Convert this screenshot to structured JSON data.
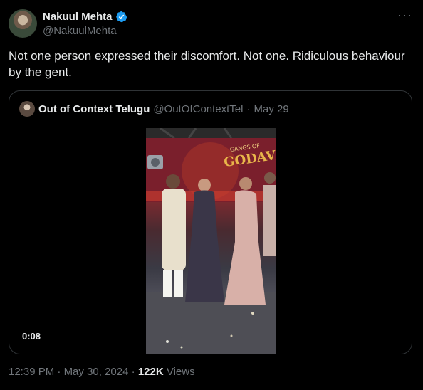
{
  "author": {
    "name": "Nakuul Mehta",
    "handle": "@NakuulMehta",
    "avatar_icon": "avatar-photo",
    "verified_icon": "verified-badge-icon",
    "verified_color": "#1d9bf0"
  },
  "more_icon": "more-options-icon",
  "tweet": {
    "text": "Not one person expressed their discomfort. Not one. Ridiculous behaviour by the gent."
  },
  "quote": {
    "name": "Out of Context Telugu",
    "handle": "@OutOfContextTel",
    "separator": "·",
    "date": "May 29",
    "video": {
      "duration": "0:08",
      "banner_text": "GANGS OF GODAVARI"
    }
  },
  "meta": {
    "time": "12:39 PM",
    "separator1": "·",
    "date": "May 30, 2024",
    "separator2": "·",
    "views_count": "122K",
    "views_label": "Views"
  },
  "colors": {
    "background": "#000000",
    "text": "#e7e9ea",
    "muted": "#71767b",
    "border": "#2f3336"
  }
}
